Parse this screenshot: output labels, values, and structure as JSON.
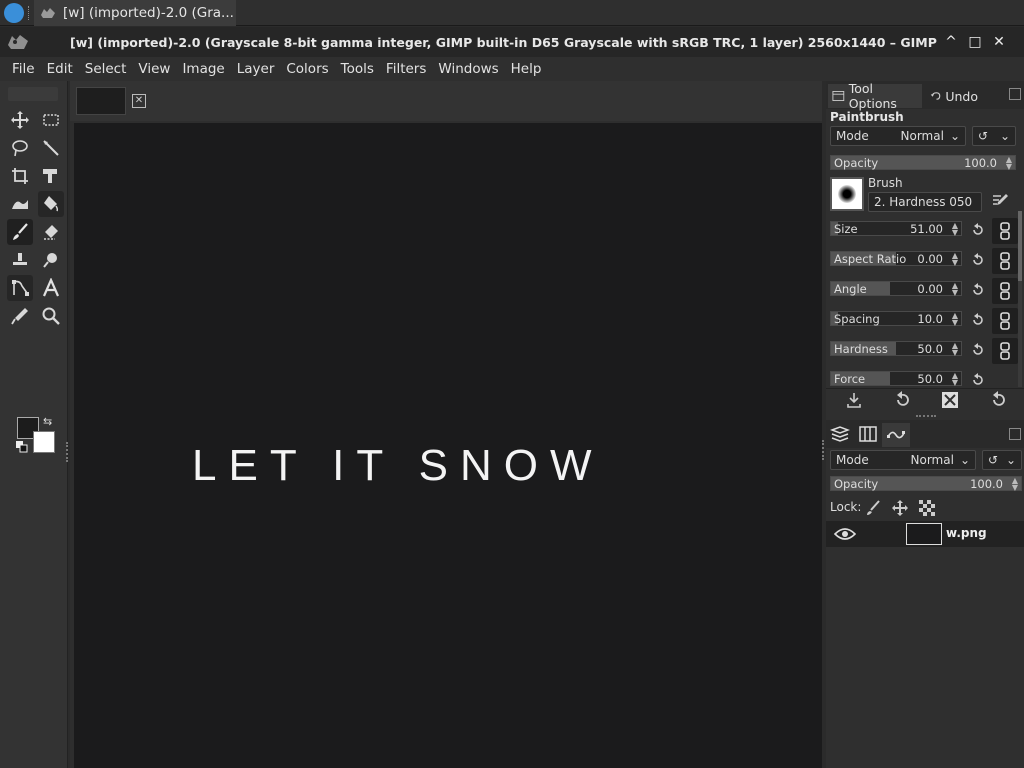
{
  "taskbar": {
    "task_title": "[w] (imported)-2.0 (Gra..."
  },
  "window": {
    "title": "[w] (imported)-2.0 (Grayscale 8-bit gamma integer, GIMP built-in D65 Grayscale with sRGB TRC, 1 layer) 2560x1440 – GIMP",
    "minimize": "^",
    "maximize": "□",
    "close": "✕"
  },
  "menu": [
    "File",
    "Edit",
    "Select",
    "View",
    "Image",
    "Layer",
    "Colors",
    "Tools",
    "Filters",
    "Windows",
    "Help"
  ],
  "canvas": {
    "text": "LET IT SNOW",
    "background": "#1b1b1c"
  },
  "tool_options": {
    "tab_label": "Tool Options",
    "undo_tab_label": "Undo",
    "tool_name": "Paintbrush",
    "mode_label": "Mode",
    "mode_value": "Normal",
    "opacity": {
      "label": "Opacity",
      "value": "100.0",
      "fraction": 1.0
    },
    "brush_label": "Brush",
    "brush_name": "2. Hardness 050",
    "properties": [
      {
        "label": "Size",
        "value": "51.00",
        "fraction": 0.05
      },
      {
        "label": "Aspect Ratio",
        "value": "0.00",
        "fraction": 0.5
      },
      {
        "label": "Angle",
        "value": "0.00",
        "fraction": 0.45
      },
      {
        "label": "Spacing",
        "value": "10.0",
        "fraction": 0.05
      },
      {
        "label": "Hardness",
        "value": "50.0",
        "fraction": 0.5
      },
      {
        "label": "Force",
        "value": "50.0",
        "fraction": 0.45
      }
    ]
  },
  "layers": {
    "mode_label": "Mode",
    "mode_value": "Normal",
    "opacity_label": "Opacity",
    "opacity_value": "100.0",
    "lock_label": "Lock:",
    "items": [
      {
        "name": "w.png",
        "visible": true
      }
    ]
  }
}
